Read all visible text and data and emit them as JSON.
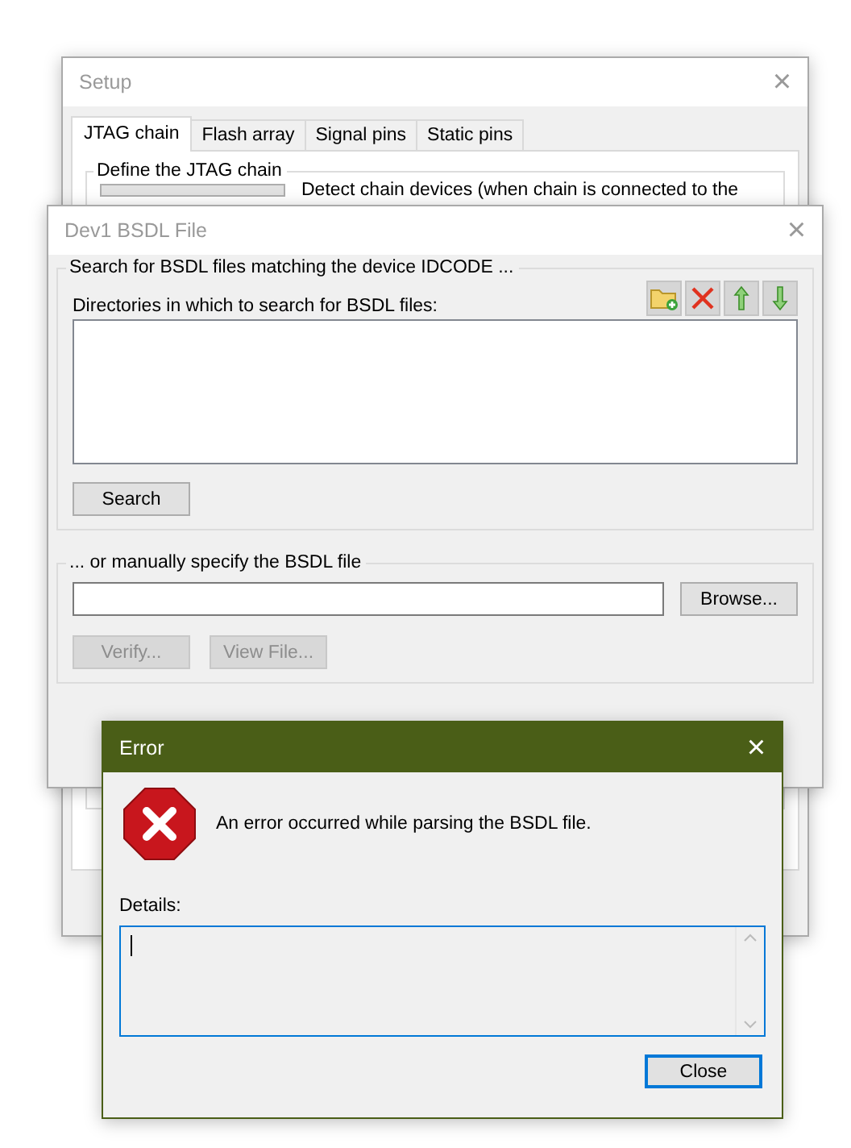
{
  "setup_window": {
    "title": "Setup",
    "close": "×",
    "tabs": [
      {
        "label": "JTAG chain",
        "selected": true
      },
      {
        "label": "Flash array",
        "selected": false
      },
      {
        "label": "Signal pins",
        "selected": false
      },
      {
        "label": "Static pins",
        "selected": false
      }
    ],
    "group_title": "Define the JTAG chain",
    "detect_text": "Detect chain devices (when chain is connected to the"
  },
  "bsdl_window": {
    "title": "Dev1 BSDL File",
    "close": "×",
    "search_group": {
      "title": "Search for BSDL files matching the device IDCODE ...",
      "directories_label": "Directories in which to search for BSDL files:",
      "toolbar": [
        {
          "kind": "add"
        },
        {
          "kind": "remove"
        },
        {
          "kind": "up"
        },
        {
          "kind": "down"
        }
      ],
      "search_button": "Search"
    },
    "manual_group": {
      "title": "... or manually specify the BSDL file",
      "browse_button": "Browse...",
      "buttons": [
        {
          "label": "Verify...",
          "disabled": true
        },
        {
          "label": "View File...",
          "disabled": true
        }
      ]
    }
  },
  "error_dialog": {
    "title": "Error",
    "close": "×",
    "message": "An error occurred while parsing the BSDL file.",
    "details_label": "Details:",
    "close_button": "Close"
  }
}
